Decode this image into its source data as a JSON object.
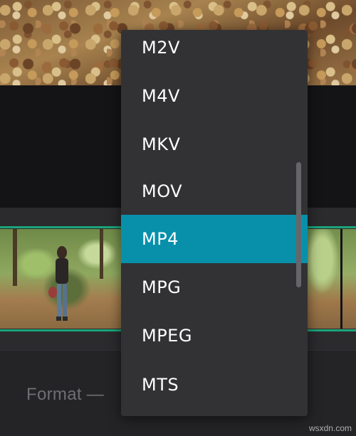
{
  "format_dropdown": {
    "options": [
      "M2V",
      "M4V",
      "MKV",
      "MOV",
      "MP4",
      "MPG",
      "MPEG",
      "MTS"
    ],
    "selected": "MP4",
    "selected_color": "#0890ab"
  },
  "format_field": {
    "label": "Format —"
  },
  "watermark": {
    "text": "wsxdn.com"
  },
  "colors": {
    "timeline_border": "#1aa57a",
    "dropdown_bg": "#323234",
    "background": "#222225"
  }
}
